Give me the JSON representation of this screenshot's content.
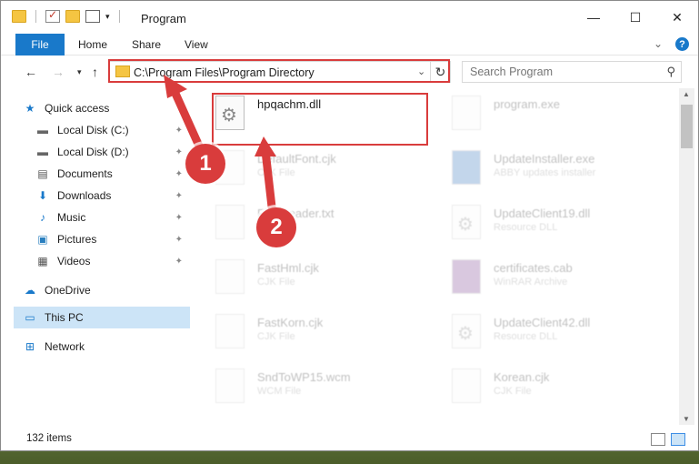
{
  "window": {
    "title": "Program"
  },
  "ribbon": {
    "file": "File",
    "home": "Home",
    "share": "Share",
    "view": "View",
    "help": "?"
  },
  "address": {
    "path": "C:\\Program Files\\Program Directory"
  },
  "search": {
    "placeholder": "Search Program"
  },
  "sidebar": {
    "items": [
      {
        "label": "Quick access",
        "icon": "star-icon"
      },
      {
        "label": "Local Disk (C:)",
        "icon": "drive-icon"
      },
      {
        "label": "Local Disk (D:)",
        "icon": "drive-icon"
      },
      {
        "label": "Documents",
        "icon": "documents-icon"
      },
      {
        "label": "Downloads",
        "icon": "download-arrow-icon"
      },
      {
        "label": "Music",
        "icon": "music-note-icon"
      },
      {
        "label": "Pictures",
        "icon": "pictures-icon"
      },
      {
        "label": "Videos",
        "icon": "videos-icon"
      },
      {
        "label": "OneDrive",
        "icon": "cloud-icon"
      },
      {
        "label": "This PC",
        "icon": "monitor-icon"
      },
      {
        "label": "Network",
        "icon": "network-icon"
      }
    ]
  },
  "files": [
    {
      "name": "hpqachm.dll",
      "type": ""
    },
    {
      "name": "program.exe",
      "type": ""
    },
    {
      "name": "DefaultFont.cjk",
      "type": "CJK File"
    },
    {
      "name": "UpdateInstaller.exe",
      "type": "ABBY updates installer"
    },
    {
      "name": "FineReader.txt",
      "type": ""
    },
    {
      "name": "UpdateClient19.dll",
      "type": "Resource DLL"
    },
    {
      "name": "FastHml.cjk",
      "type": "CJK File"
    },
    {
      "name": "certificates.cab",
      "type": "WinRAR Archive"
    },
    {
      "name": "FastKorn.cjk",
      "type": "CJK File"
    },
    {
      "name": "UpdateClient42.dll",
      "type": "Resource DLL"
    },
    {
      "name": "SndToWP15.wcm",
      "type": "WCM File"
    },
    {
      "name": "Korean.cjk",
      "type": "CJK File"
    }
  ],
  "status": {
    "item_count": "132 items"
  },
  "annotations": {
    "badge1": "1",
    "badge2": "2"
  },
  "colors": {
    "accent": "#1979ca",
    "highlight": "#d93c3c",
    "selected": "#cce4f7"
  }
}
